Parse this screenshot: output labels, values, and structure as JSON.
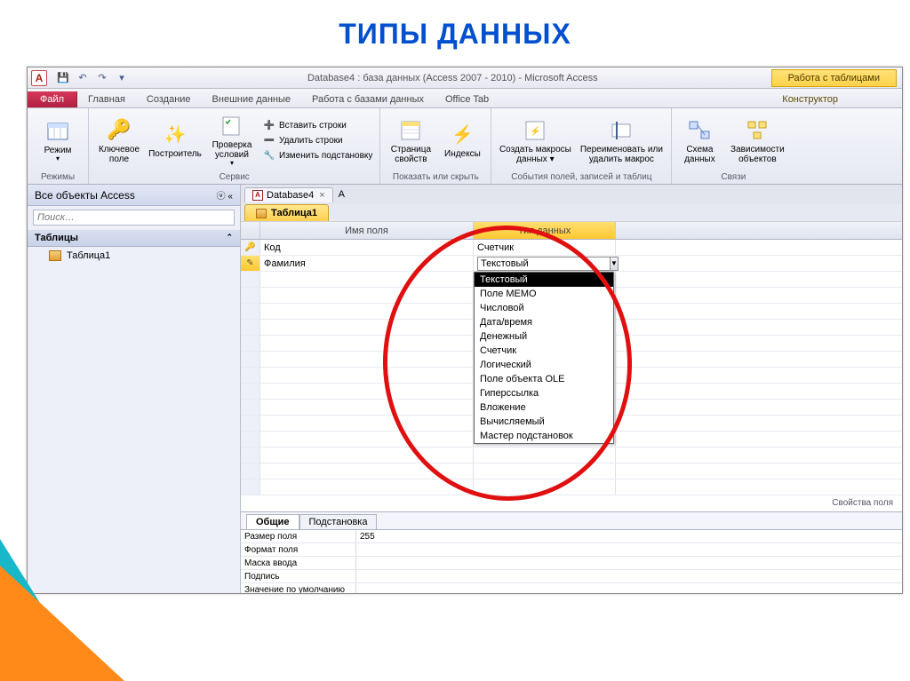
{
  "slide": {
    "title": "ТИПЫ ДАННЫХ"
  },
  "titlebar": {
    "text": "Database4 : база данных (Access 2007 - 2010)  -  Microsoft Access",
    "context_title": "Работа с таблицами"
  },
  "tabs": {
    "file": "Файл",
    "home": "Главная",
    "create": "Создание",
    "external": "Внешние данные",
    "dbtools": "Работа с базами данных",
    "officetab": "Office Tab",
    "constructor": "Конструктор"
  },
  "ribbon": {
    "view": {
      "label": "Режим",
      "group": "Режимы"
    },
    "tools": {
      "key": "Ключевое поле",
      "builder": "Построитель",
      "validate": "Проверка условий",
      "insert_rows": "Вставить строки",
      "delete_rows": "Удалить строки",
      "modify_lookup": "Изменить подстановку",
      "group": "Сервис"
    },
    "showhide": {
      "property_sheet": "Страница свойств",
      "indexes": "Индексы",
      "group": "Показать или скрыть"
    },
    "events": {
      "create_macros": "Создать макросы данных ▾",
      "rename_delete": "Переименовать или удалить макрос",
      "group": "События полей, записей и таблиц"
    },
    "relations": {
      "schema": "Схема данных",
      "deps": "Зависимости объектов",
      "group": "Связи"
    }
  },
  "nav": {
    "header": "Все объекты Access",
    "search_placeholder": "Поиск…",
    "section": "Таблицы",
    "item1": "Таблица1"
  },
  "doc": {
    "name": "Database4",
    "table_tab": "Таблица1"
  },
  "grid": {
    "col_name": "Имя поля",
    "col_type": "Тип данных",
    "rows": [
      {
        "name": "Код",
        "type": "Счетчик",
        "pk": true
      },
      {
        "name": "Фамилия",
        "type": "Текстовый",
        "editing": true
      }
    ],
    "dropdown": [
      "Текстовый",
      "Поле МЕМО",
      "Числовой",
      "Дата/время",
      "Денежный",
      "Счетчик",
      "Логический",
      "Поле объекта OLE",
      "Гиперссылка",
      "Вложение",
      "Вычисляемый",
      "Мастер подстановок"
    ],
    "dropdown_selected": 0
  },
  "props": {
    "caption": "Свойства поля",
    "tab_general": "Общие",
    "tab_lookup": "Подстановка",
    "rows": [
      {
        "name": "Размер поля",
        "value": "255"
      },
      {
        "name": "Формат поля",
        "value": ""
      },
      {
        "name": "Маска ввода",
        "value": ""
      },
      {
        "name": "Подпись",
        "value": ""
      },
      {
        "name": "Значение по умолчанию",
        "value": ""
      }
    ]
  }
}
